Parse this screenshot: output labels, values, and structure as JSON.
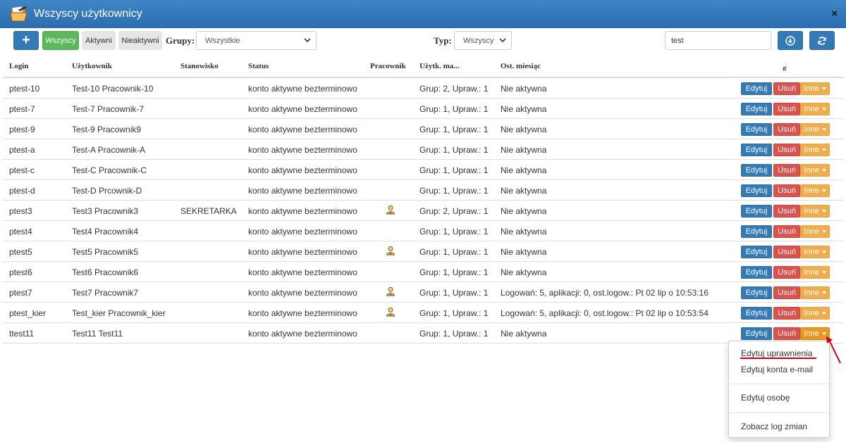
{
  "window": {
    "title": "Wszyscy użytkownicy",
    "close_label": "×",
    "icon": "folder-icon"
  },
  "toolbar": {
    "add_label": "+",
    "filters": {
      "all": "Wszyscy",
      "active": "Aktywni",
      "inactive": "Nieaktywni"
    },
    "groups_label": "Grupy:",
    "groups_value": "Wszystkie",
    "type_label": "Typ:",
    "type_value": "Wszyscy",
    "search_value": "test",
    "download_icon": "download-icon",
    "refresh_icon": "refresh-icon"
  },
  "table": {
    "headers": {
      "login": "Login",
      "user": "Użytkownik",
      "position": "Stanowisko",
      "status": "Status",
      "employee": "Pracownik",
      "groups": "Użytk. ma...",
      "last_month": "Ost. miesiąc",
      "actions": "#"
    },
    "action_labels": {
      "edit": "Edytuj",
      "delete": "Usuń",
      "more": "Inne"
    },
    "rows": [
      {
        "login": "ptest-10",
        "user": "Test-10 Pracownik-10",
        "position": "",
        "status": "konto aktywne bezterminowo",
        "employee": false,
        "groups": "Grup: 2, Upraw.: 1",
        "last_month": "Nie aktywna"
      },
      {
        "login": "ptest-7",
        "user": "Test-7 Pracownik-7",
        "position": "",
        "status": "konto aktywne bezterminowo",
        "employee": false,
        "groups": "Grup: 1, Upraw.: 1",
        "last_month": "Nie aktywna"
      },
      {
        "login": "ptest-9",
        "user": "Test-9 Pracownik9",
        "position": "",
        "status": "konto aktywne bezterminowo",
        "employee": false,
        "groups": "Grup: 1, Upraw.: 1",
        "last_month": "Nie aktywna"
      },
      {
        "login": "ptest-a",
        "user": "Test-A Pracownik-A",
        "position": "",
        "status": "konto aktywne bezterminowo",
        "employee": false,
        "groups": "Grup: 1, Upraw.: 1",
        "last_month": "Nie aktywna"
      },
      {
        "login": "ptest-c",
        "user": "Test-C Pracownik-C",
        "position": "",
        "status": "konto aktywne bezterminowo",
        "employee": false,
        "groups": "Grup: 1, Upraw.: 1",
        "last_month": "Nie aktywna"
      },
      {
        "login": "ptest-d",
        "user": "Test-D Prcownik-D",
        "position": "",
        "status": "konto aktywne bezterminowo",
        "employee": false,
        "groups": "Grup: 1, Upraw.: 1",
        "last_month": "Nie aktywna"
      },
      {
        "login": "ptest3",
        "user": "Test3 Pracownik3",
        "position": "SEKRETARKA",
        "status": "konto aktywne bezterminowo",
        "employee": true,
        "groups": "Grup: 2, Upraw.: 1",
        "last_month": "Nie aktywna"
      },
      {
        "login": "ptest4",
        "user": "Test4 Pracownik4",
        "position": "",
        "status": "konto aktywne bezterminowo",
        "employee": false,
        "groups": "Grup: 1, Upraw.: 1",
        "last_month": "Nie aktywna"
      },
      {
        "login": "ptest5",
        "user": "Test5 Pracownik5",
        "position": "",
        "status": "konto aktywne bezterminowo",
        "employee": true,
        "groups": "Grup: 1, Upraw.: 1",
        "last_month": "Nie aktywna"
      },
      {
        "login": "ptest6",
        "user": "Test6 Pracownik6",
        "position": "",
        "status": "konto aktywne bezterminowo",
        "employee": false,
        "groups": "Grup: 1, Upraw.: 1",
        "last_month": "Nie aktywna"
      },
      {
        "login": "ptest7",
        "user": "Test7 Pracownik7",
        "position": "",
        "status": "konto aktywne bezterminowo",
        "employee": true,
        "groups": "Grup: 1, Upraw.: 1",
        "last_month": "Logowań: 5, aplikacji: 0, ost.logow.: Pt 02 lip o 10:53:16"
      },
      {
        "login": "ptest_kier",
        "user": "Test_kier Pracownik_kier",
        "position": "",
        "status": "konto aktywne bezterminowo",
        "employee": true,
        "groups": "Grup: 1, Upraw.: 1",
        "last_month": "Logowań: 5, aplikacji: 0, ost.logow.: Pt 02 lip o 10:53:54"
      },
      {
        "login": "ttest11",
        "user": "Test11 Test11",
        "position": "",
        "status": "konto aktywne bezterminowo",
        "employee": false,
        "groups": "Grup: 1, Upraw.: 1",
        "last_month": "Nie aktywna"
      }
    ]
  },
  "dropdown": {
    "items": [
      "Edytuj uprawnienia",
      "Edytuj konta e-mail",
      "Edytuj osobę",
      "Zobacz log zmian"
    ],
    "highlighted_item": "Edytuj uprawnienia",
    "highlight_color": "#d0021b"
  },
  "colors": {
    "titlebar": "#2f74b8",
    "primary": "#337ab7",
    "success": "#5cb85c",
    "danger": "#d9534f",
    "warning": "#f0ad4e"
  }
}
